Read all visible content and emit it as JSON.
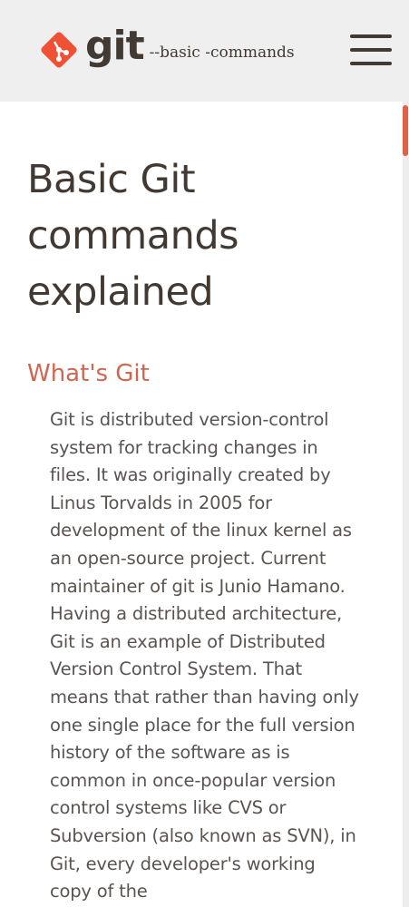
{
  "header": {
    "logo_word": "git",
    "logo_tag": "--basic -commands",
    "menu_icon": "hamburger-menu-icon"
  },
  "main": {
    "title": "Basic Git commands explained",
    "sections": [
      {
        "heading": "What's Git",
        "body": "Git is distributed version-control system for tracking changes in files. It was originally created by Linus Torvalds in 2005 for development of the linux kernel as an open-source project. Current maintainer of git is Junio Hamano. Having a distributed architecture, Git is an example of Distributed Version Control System. That means that rather than having only one single place for the full version history of the software as is common in once-popular version control systems like CVS or Subversion (also known as SVN), in Git, every developer's working copy of the"
      }
    ]
  },
  "colors": {
    "accent": "#d0664f",
    "logo_orange": "#f05033",
    "text_dark": "#413932",
    "text_body": "#5a5450",
    "header_bg": "#efefef",
    "scrollbar_thumb": "#e06244"
  }
}
